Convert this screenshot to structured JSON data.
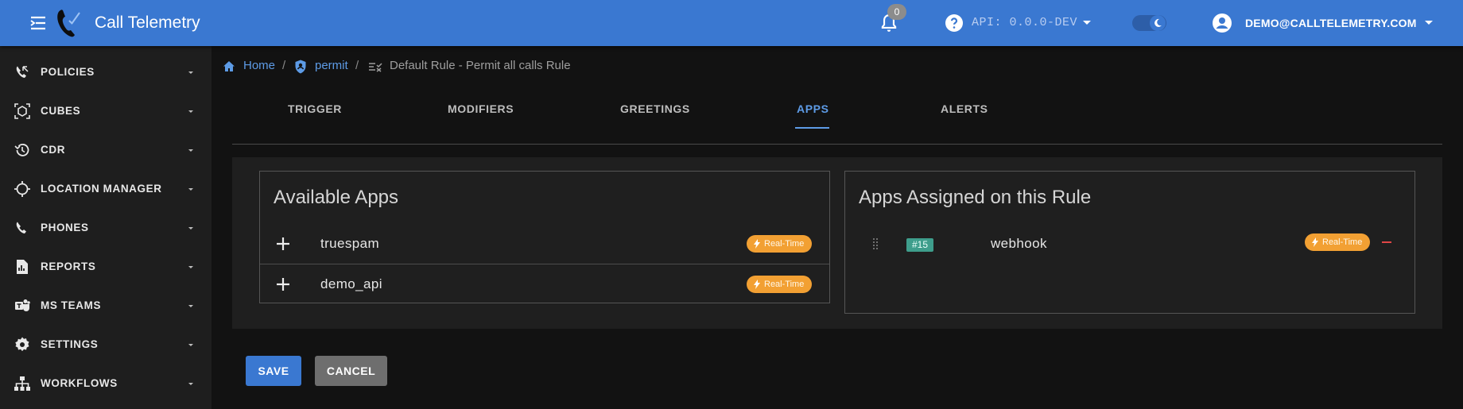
{
  "header": {
    "app_title": "Call Telemetry",
    "notification_count": "0",
    "api_version": "API: 0.0.0-DEV",
    "user_email": "DEMO@CALLTELEMETRY.COM",
    "brand_color": "#3a78d1"
  },
  "sidebar": {
    "items": [
      {
        "label": "POLICIES",
        "icon": "phone-callback-icon"
      },
      {
        "label": "CUBES",
        "icon": "cube-scan-icon"
      },
      {
        "label": "CDR",
        "icon": "history-icon"
      },
      {
        "label": "LOCATION MANAGER",
        "icon": "crosshairs-icon"
      },
      {
        "label": "PHONES",
        "icon": "phone-icon"
      },
      {
        "label": "REPORTS",
        "icon": "report-icon"
      },
      {
        "label": "MS TEAMS",
        "icon": "teams-icon"
      },
      {
        "label": "SETTINGS",
        "icon": "gear-icon"
      },
      {
        "label": "WORKFLOWS",
        "icon": "sitemap-icon"
      }
    ]
  },
  "breadcrumb": {
    "home": "Home",
    "sep": "/",
    "policy": "permit",
    "current": "Default Rule - Permit all calls Rule"
  },
  "tabs": {
    "items": [
      "TRIGGER",
      "MODIFIERS",
      "GREETINGS",
      "APPS",
      "ALERTS"
    ],
    "active": "APPS"
  },
  "available_apps": {
    "title": "Available Apps",
    "items": [
      {
        "name": "truespam",
        "badge": "Real-Time"
      },
      {
        "name": "demo_api",
        "badge": "Real-Time"
      }
    ]
  },
  "assigned_apps": {
    "title": "Apps Assigned on this Rule",
    "items": [
      {
        "id": "#15",
        "name": "webhook",
        "badge": "Real-Time"
      }
    ]
  },
  "actions": {
    "save": "SAVE",
    "cancel": "CANCEL"
  },
  "colors": {
    "badge_realtime": "#f2a033",
    "id_tag": "#3e9e8c",
    "remove": "#e04646",
    "link": "#5d9be6"
  }
}
